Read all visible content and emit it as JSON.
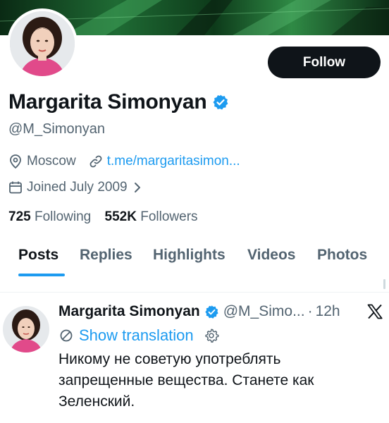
{
  "profile": {
    "name": "Margarita Simonyan",
    "handle": "@M_Simonyan",
    "location": "Moscow",
    "link": "t.me/margaritasimon...",
    "joined": "Joined July 2009",
    "following_count": "725",
    "following_label": "Following",
    "followers_count": "552K",
    "followers_label": "Followers",
    "verified": true
  },
  "actions": {
    "follow_label": "Follow"
  },
  "tabs": [
    {
      "label": "Posts",
      "active": true
    },
    {
      "label": "Replies"
    },
    {
      "label": "Highlights"
    },
    {
      "label": "Videos"
    },
    {
      "label": "Photos"
    }
  ],
  "tweet": {
    "name": "Margarita Simonyan",
    "handle": "@M_Simo...",
    "separator": "·",
    "time": "12h",
    "translate_label": "Show translation",
    "text": "Никому не советую употреблять запрещенные вещества. Станете как Зеленский."
  },
  "icons": {
    "verified": "verified-badge-icon",
    "location": "location-pin-icon",
    "link": "link-icon",
    "calendar": "calendar-icon",
    "chevron": "chevron-right-icon",
    "translate": "translate-icon",
    "settings": "gear-icon",
    "platform": "x-logo-icon"
  },
  "colors": {
    "accent": "#1d9bf0",
    "text": "#0f1419",
    "muted": "#536471",
    "button_bg": "#0f1419",
    "banner": "#1f6b34"
  }
}
